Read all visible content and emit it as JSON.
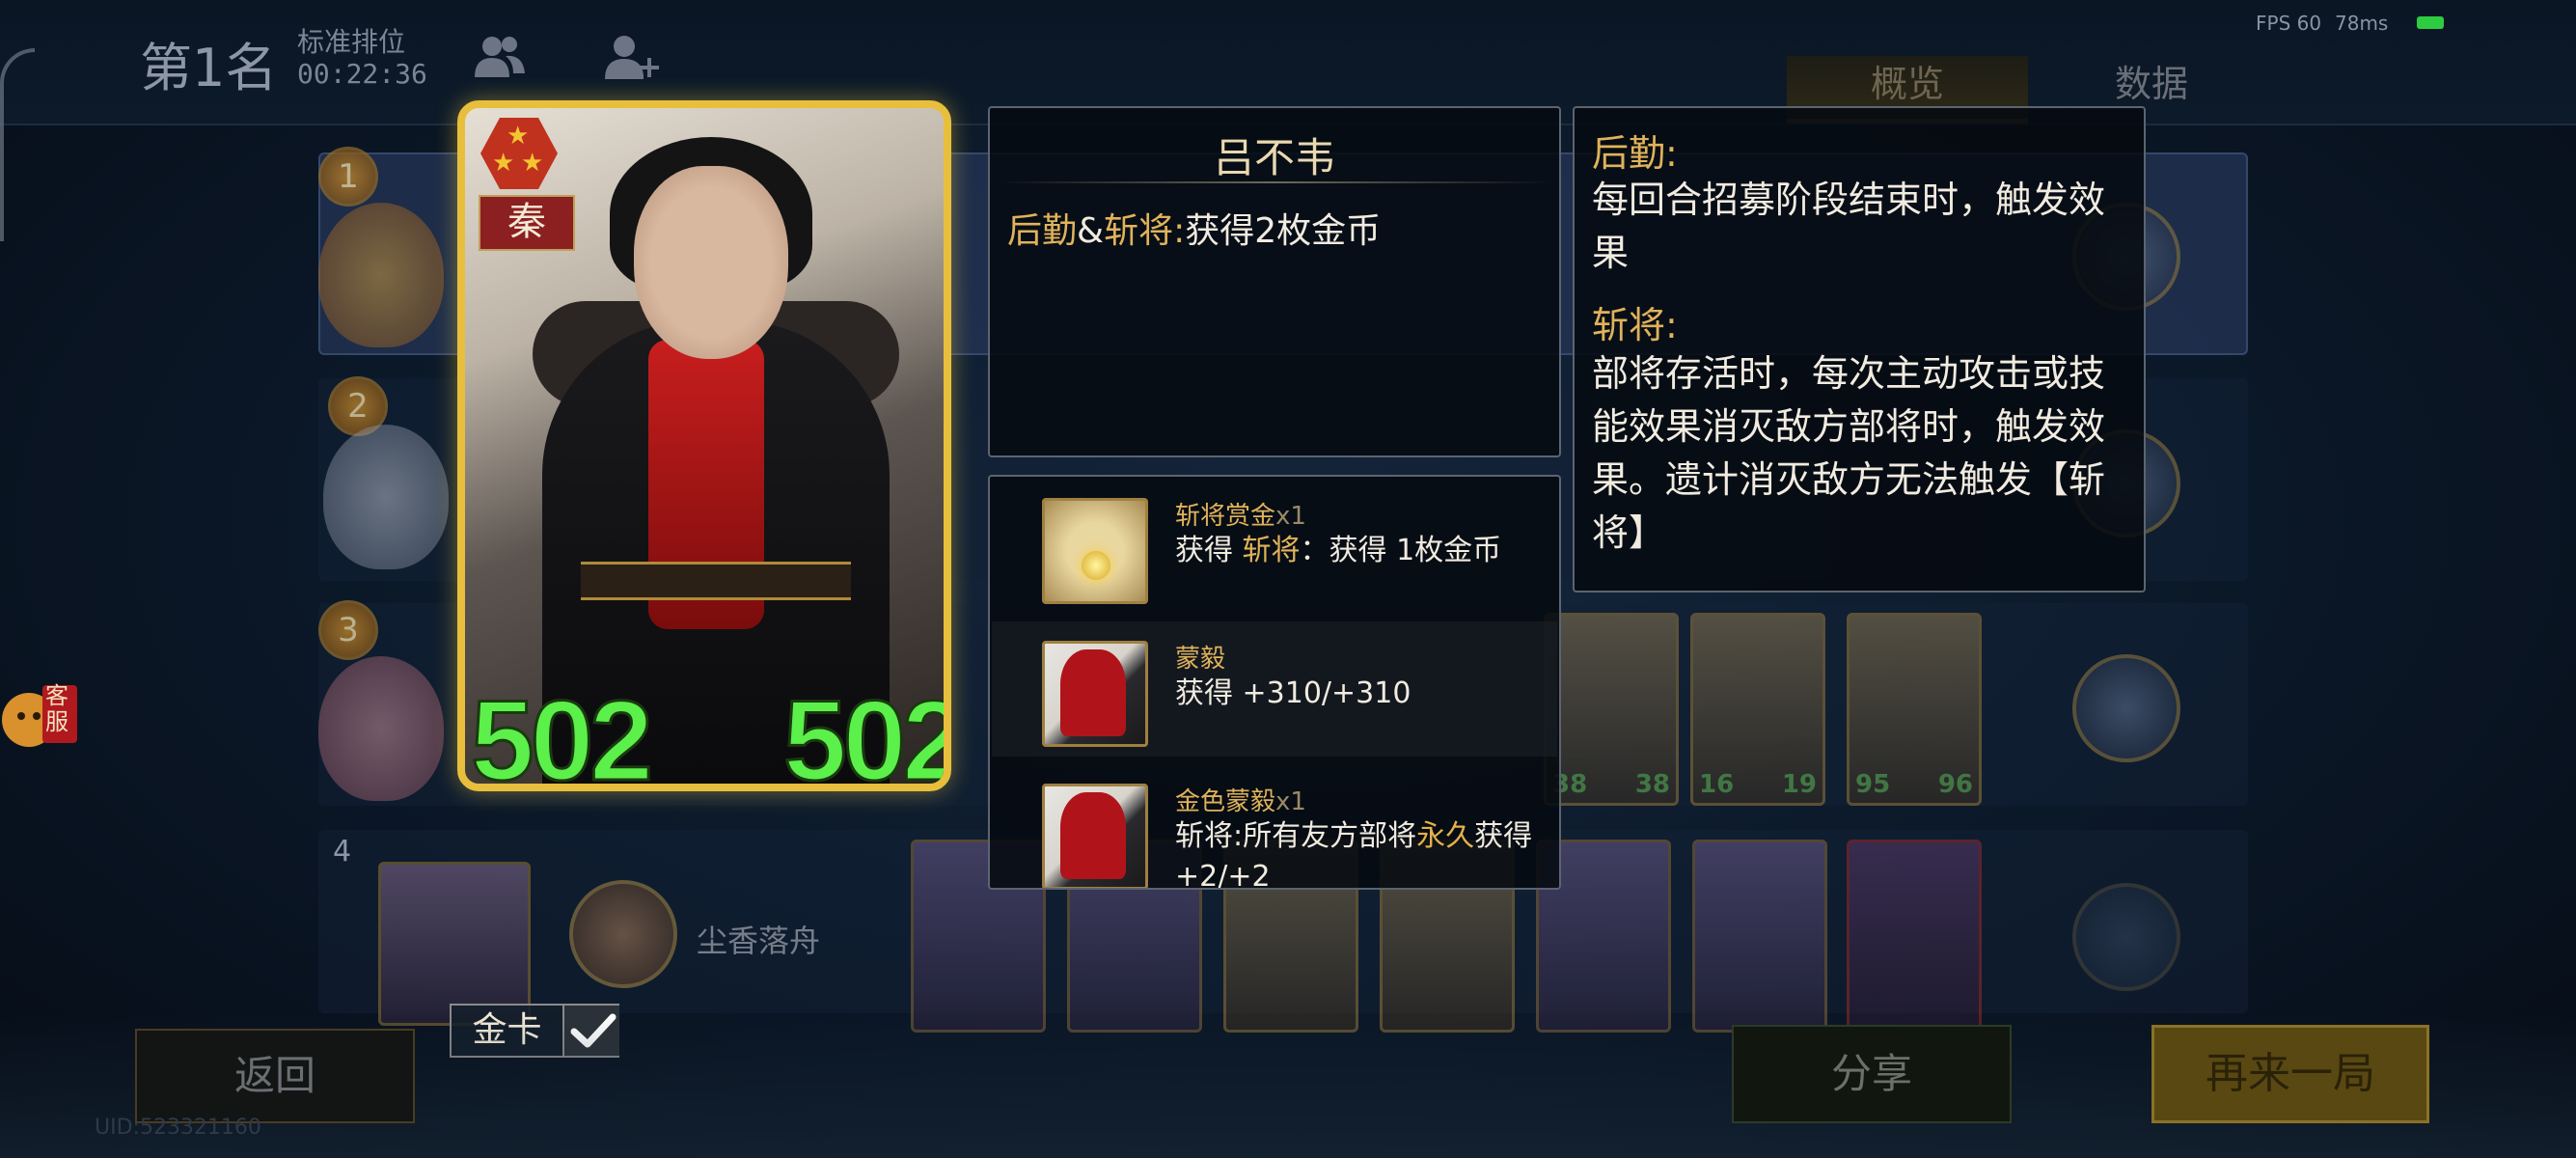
{
  "header": {
    "rank_title": "第1名",
    "mode": "标准排位",
    "timer": "00:22:36",
    "fps": "FPS 60",
    "ping": "78ms",
    "icons": [
      "friends-icon",
      "add-friend-icon",
      "wifi-signal-icon"
    ]
  },
  "tabs": [
    {
      "label": "概览",
      "active": true
    },
    {
      "label": "数据",
      "active": false
    }
  ],
  "ranking": {
    "rows": [
      {
        "rank": "1"
      },
      {
        "rank": "2"
      },
      {
        "rank": "3",
        "visible_stats": [
          "38",
          "38",
          "16",
          "19",
          "95",
          "96"
        ],
        "round_badge": "0"
      },
      {
        "rank": "4",
        "player_name": "尘香落舟",
        "round_badge": "1"
      }
    ]
  },
  "card": {
    "faction": "秦",
    "stars": 3,
    "attack": "502",
    "health": "502",
    "gold_toggle_label": "金卡",
    "gold_toggle_checked": true
  },
  "ability": {
    "name": "吕不韦",
    "kw1": "后勤",
    "sep": "&",
    "kw2": "斩将",
    "colon": ":",
    "effect": "获得2枚金币"
  },
  "keywords": [
    {
      "title": "后勤:",
      "desc": "每回合招募阶段结束时，触发效果"
    },
    {
      "title": "斩将:",
      "desc": "部将存活时，每次主动攻击或技能效果消灭敌方部将时，触发效果。遗计消灭敌方无法触发【斩将】"
    }
  ],
  "related": [
    {
      "title": "斩将赏金",
      "qty": "x1",
      "pre": "获得 ",
      "kw": "斩将",
      "post": "：获得 1枚金币",
      "icon": "bounty-scroll-icon"
    },
    {
      "title": "蒙毅",
      "qty": "",
      "pre": "获得 +310/+310",
      "kw": "",
      "post": "",
      "icon": "meng-yi-portrait-icon"
    },
    {
      "title": "金色蒙毅",
      "qty": "x1",
      "pre": "斩将:所有友方部将",
      "kw": "永久",
      "post": "获得+2/+2",
      "icon": "golden-meng-yi-portrait-icon"
    }
  ],
  "buttons": {
    "back": "返回",
    "share": "分享",
    "again": "再来一局"
  },
  "cs_badge": "客服",
  "uid": "UID:523321160",
  "colors": {
    "accent_gold": "#e7bf3c",
    "stat_green": "#5cf04a",
    "keyword_gold": "#e0b35a",
    "faction_red": "#8c1f1f"
  }
}
